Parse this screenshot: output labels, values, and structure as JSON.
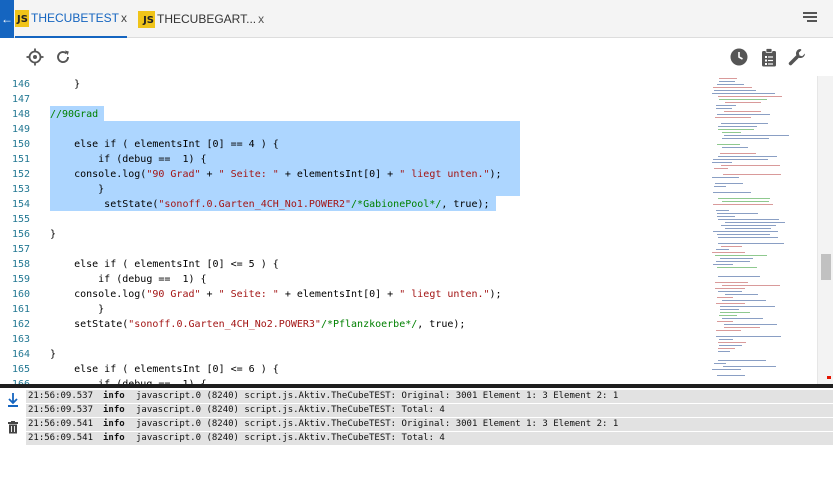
{
  "tabs": [
    {
      "badge": "JS",
      "label": "THECUBETEST",
      "close": "x"
    },
    {
      "badge": "JS",
      "label": "THECUBEGART...",
      "close": "x"
    }
  ],
  "toolbar": {
    "left_icons": [
      "target-icon",
      "refresh-icon"
    ],
    "right_icons": [
      "clock-icon",
      "clipboard-icon",
      "wrench-icon"
    ]
  },
  "editor": {
    "lines": [
      {
        "n": "146",
        "t": "    }"
      },
      {
        "n": "147",
        "t": ""
      },
      {
        "n": "148",
        "t": "//90Grad"
      },
      {
        "n": "149",
        "t": ""
      },
      {
        "n": "150",
        "t": "    else if ( elementsInt [0] == 4 ) {"
      },
      {
        "n": "151",
        "t": "        if (debug ==  1) {"
      },
      {
        "n": "152",
        "t": "    console.log(\"90 Grad\" + \" Seite: \" + elementsInt[0] + \" liegt unten.\");"
      },
      {
        "n": "153",
        "t": "        }"
      },
      {
        "n": "154",
        "t": "         setState(\"sonoff.0.Garten_4CH_No1.POWER2\"/*GabionePool*/, true);"
      },
      {
        "n": "155",
        "t": ""
      },
      {
        "n": "156",
        "t": "}"
      },
      {
        "n": "157",
        "t": ""
      },
      {
        "n": "158",
        "t": "    else if ( elementsInt [0] <= 5 ) {"
      },
      {
        "n": "159",
        "t": "        if (debug ==  1) {"
      },
      {
        "n": "160",
        "t": "    console.log(\"90 Grad\" + \" Seite: \" + elementsInt[0] + \" liegt unten.\");"
      },
      {
        "n": "161",
        "t": "        }"
      },
      {
        "n": "162",
        "t": "    setState(\"sonoff.0.Garten_4CH_No2.POWER3\"/*Pflanzkoerbe*/, true);"
      },
      {
        "n": "163",
        "t": ""
      },
      {
        "n": "164",
        "t": "}"
      },
      {
        "n": "165",
        "t": "    else if ( elementsInt [0] <= 6 ) {"
      },
      {
        "n": "166",
        "t": "        if (debug ==  1) {"
      }
    ]
  },
  "log": [
    {
      "time": "21:56:09.537",
      "level": "info",
      "msg": "javascript.0 (8240) script.js.Aktiv.TheCubeTEST: Original: 3001 Element 1: 3 Element 2: 1"
    },
    {
      "time": "21:56:09.537",
      "level": "info",
      "msg": "javascript.0 (8240) script.js.Aktiv.TheCubeTEST: Total: 4"
    },
    {
      "time": "21:56:09.541",
      "level": "info",
      "msg": "javascript.0 (8240) script.js.Aktiv.TheCubeTEST: Original: 3001 Element 1: 3 Element 2: 1"
    },
    {
      "time": "21:56:09.541",
      "level": "info",
      "msg": "javascript.0 (8240) script.js.Aktiv.TheCubeTEST: Total: 4"
    }
  ],
  "colors": {
    "accent": "#1565c0",
    "js_badge": "#f0c419",
    "selection": "#add6ff",
    "line_numbers": "#237893",
    "string": "#a31515",
    "comment": "#008000",
    "log_row": "#e2e2e2"
  }
}
